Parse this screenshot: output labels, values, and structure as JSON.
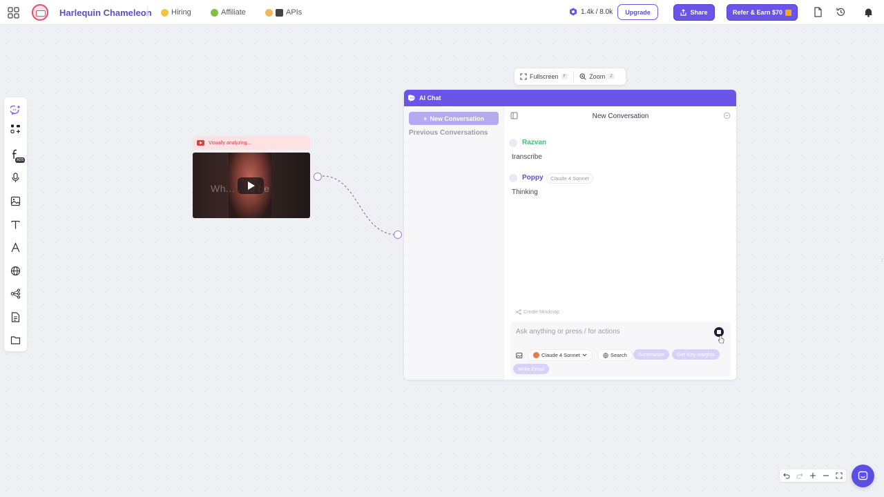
{
  "topbar": {
    "project_name": "Harlequin Chameleon",
    "links": [
      {
        "label": "Hiring",
        "icon": "smiling-face-icon"
      },
      {
        "label": "Affiliate",
        "icon": "money-face-icon"
      },
      {
        "label": "APIs",
        "icon": "technologist-icon"
      }
    ],
    "credits": "1.4k / 8.0k",
    "upgrade_label": "Upgrade",
    "share_label": "Share",
    "refer_label": "Refer & Earn $70"
  },
  "left_toolbar": {
    "ads_badge": "ADS"
  },
  "video_node": {
    "status": "Visually analyzing...",
    "caption": "Wh... ...ld be"
  },
  "view_controls": {
    "fullscreen_label": "Fullscreen",
    "fullscreen_key": "F",
    "zoom_label": "Zoom",
    "zoom_key": "Z"
  },
  "chat": {
    "header_title": "AI Chat",
    "new_conversation_label": "New Conversation",
    "previous_label": "Previous Conversations",
    "conversation_title": "New Conversation",
    "messages": [
      {
        "author": "Razvan",
        "text": "transcribe",
        "color": "#3cc46d"
      },
      {
        "author": "Poppy",
        "model": "Claude 4 Sonnet",
        "text": "Thinking",
        "color": "#5b4fe3"
      }
    ],
    "mindmap_hint": "Create Mindmap",
    "input_placeholder": "Ask anything or press / for actions",
    "model_chip": "Claude 4 Sonnet",
    "search_chip": "Search",
    "suggestions": [
      "Summarize",
      "Get Key Insights",
      "Write Email"
    ]
  },
  "colors": {
    "accent": "#6a55e8",
    "brand_text": "#5b4fc7"
  }
}
